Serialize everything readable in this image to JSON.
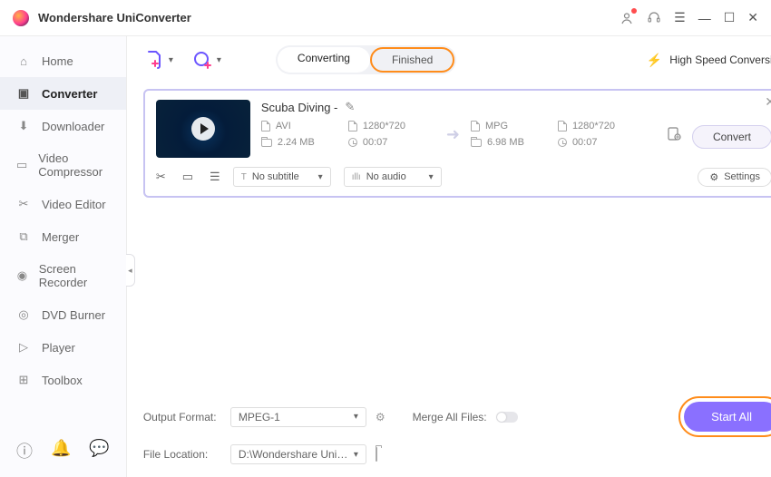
{
  "app": {
    "title": "Wondershare UniConverter"
  },
  "sidebar": {
    "items": [
      {
        "label": "Home",
        "icon": "⌂"
      },
      {
        "label": "Converter",
        "icon": "▣"
      },
      {
        "label": "Downloader",
        "icon": "⬇"
      },
      {
        "label": "Video Compressor",
        "icon": "▭"
      },
      {
        "label": "Video Editor",
        "icon": "✂"
      },
      {
        "label": "Merger",
        "icon": "⧉"
      },
      {
        "label": "Screen Recorder",
        "icon": "◉"
      },
      {
        "label": "DVD Burner",
        "icon": "◎"
      },
      {
        "label": "Player",
        "icon": "▷"
      },
      {
        "label": "Toolbox",
        "icon": "⊞"
      }
    ]
  },
  "tabs": {
    "converting": "Converting",
    "finished": "Finished"
  },
  "toolbar": {
    "hsc": "High Speed Conversion"
  },
  "file": {
    "title": "Scuba Diving -",
    "src": {
      "format": "AVI",
      "res": "1280*720",
      "size": "2.24 MB",
      "duration": "00:07"
    },
    "dst": {
      "format": "MPG",
      "res": "1280*720",
      "size": "6.98 MB",
      "duration": "00:07"
    },
    "convert_label": "Convert",
    "subtitle": "No subtitle",
    "audio": "No audio",
    "settings_label": "Settings"
  },
  "footer": {
    "output_format_label": "Output Format:",
    "output_format_value": "MPEG-1",
    "file_location_label": "File Location:",
    "file_location_value": "D:\\Wondershare UniConverter",
    "merge_label": "Merge All Files:",
    "start_all": "Start All"
  }
}
